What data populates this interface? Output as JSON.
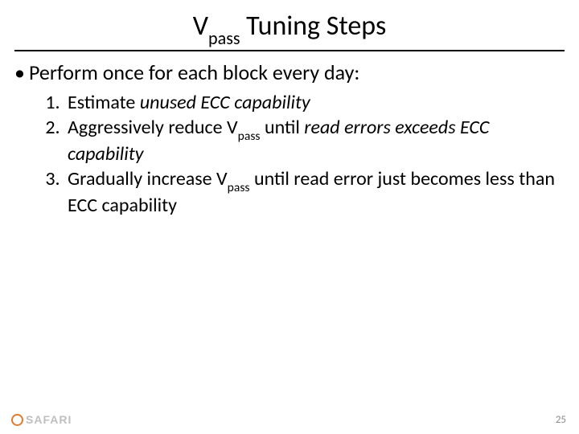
{
  "title": {
    "v": "V",
    "sub": "pass",
    "rest": " Tuning Steps"
  },
  "lead": {
    "bullet": "•",
    "text": "Perform once for each block every day:"
  },
  "steps": [
    {
      "pre": "Estimate ",
      "em1": "unused ECC capability",
      "mid": "",
      "v": "",
      "vsub": "",
      "post": "",
      "em2": ""
    },
    {
      "pre": "Aggressively reduce ",
      "em1": "",
      "mid": "",
      "v": "V",
      "vsub": "pass",
      "post": " until ",
      "em2": "read errors exceeds ECC capability"
    },
    {
      "pre": "Gradually increase ",
      "em1": "",
      "mid": "",
      "v": "V",
      "vsub": "pass",
      "post": " until read error just becomes less than ECC capability",
      "em2": ""
    }
  ],
  "footer": {
    "logo_text": "SAFARI",
    "page": "25"
  }
}
